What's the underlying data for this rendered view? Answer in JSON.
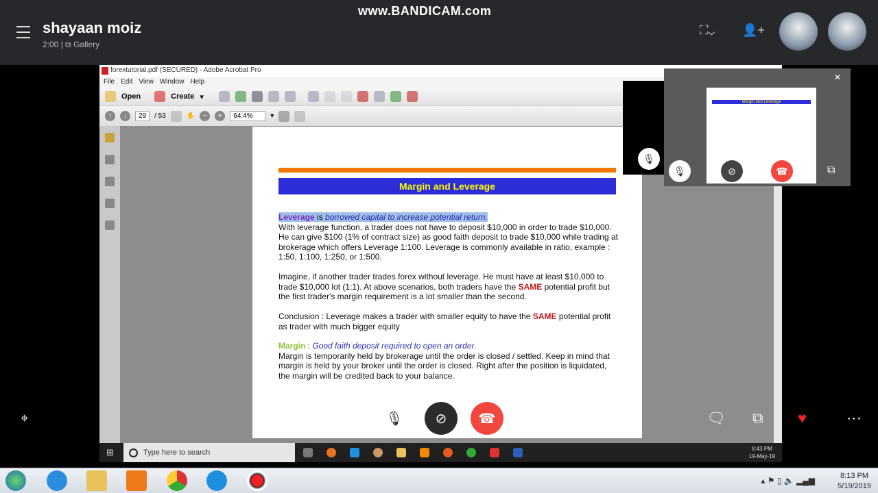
{
  "call": {
    "caller_name": "shayaan moiz",
    "duration": "2:00",
    "separator": "|",
    "view_mode": "Gallery"
  },
  "recorder_watermark": "www.BANDICAM.com",
  "acrobat": {
    "title": "forextutorial.pdf (SECURED) - Adobe Acrobat Pro",
    "menu": [
      "File",
      "Edit",
      "View",
      "Window",
      "Help"
    ],
    "open_label": "Open",
    "create_label": "Create",
    "page_current": "29",
    "page_total": "/ 53",
    "zoom": "64.4%"
  },
  "pdf": {
    "heading": "Margin and Leverage",
    "p1_term": "Leverage",
    "p1_is": " is ",
    "p1_def": "borrowed capital to increase potential return.",
    "p1_body": "With leverage function, a trader does not have to deposit $10,000 in order to trade $10,000. He can give $100 (1% of contract size) as good faith deposit to trade $10,000 while trading at brokerage which offers Leverage 1:100. Leverage is commonly available in ratio, example : 1:50, 1:100, 1:250, or 1:500.",
    "p2_a": "Imagine, if another trader trades forex without leverage. He must have at least $10,000 to trade $10,000 lot (1:1). At above scenarios, both traders have the ",
    "p2_same": "SAME",
    "p2_b": " potential profit but the first trader's margin requirement is a lot smaller than the second.",
    "p3_a": "Conclusion : Leverage makes a trader with smaller equity to have the ",
    "p3_same": "SAME",
    "p3_b": " potential profit as trader with much bigger equity",
    "p4_term": "Margin",
    "p4_sep": " : ",
    "p4_def": "Good faith deposit required to open an order.",
    "p4_body": "Margin is temporarily held by brokerage until the order is closed / settled. Keep in mind that margin is held by your broker until the order is closed. Right after the position is liquidated, the margin will be credited back to your balance.",
    "thumb_heading": "Margin and Leverage"
  },
  "inner_taskbar": {
    "search_placeholder": "Type here to search",
    "time": "8:43 PM",
    "date": "19-May-19"
  },
  "outer_taskbar": {
    "time": "8:13 PM",
    "date": "5/19/2019"
  },
  "colors": {
    "hangup": "#f2473f",
    "heart": "#e8262b",
    "banner": "#2c2cd8",
    "banner_text": "#ffff00",
    "rule": "#f07800"
  }
}
